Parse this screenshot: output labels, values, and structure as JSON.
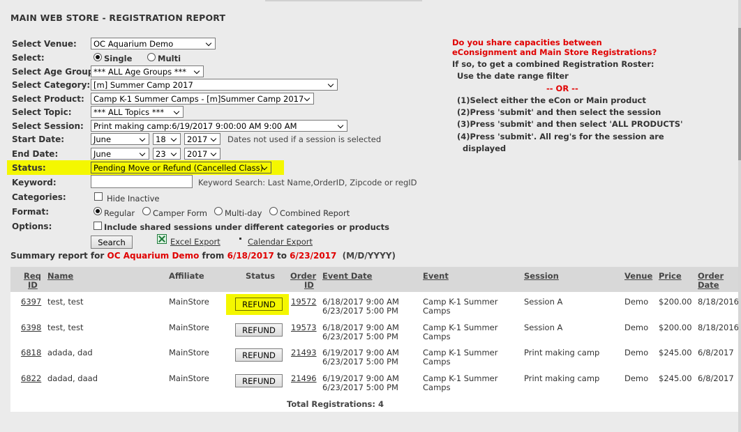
{
  "page_title": "MAIN WEB STORE - REGISTRATION REPORT",
  "form": {
    "venue_label": "Select Venue:",
    "venue_value": "OC Aquarium Demo",
    "select_label": "Select:",
    "select_options": [
      "Single",
      "Multi"
    ],
    "select_checked": "Single",
    "age_group_label": "Select Age Group:",
    "age_group_value": "*** ALL Age Groups ***",
    "category_label": "Select Category:",
    "category_value": "[m] Summer Camp 2017",
    "product_label": "Select Product:",
    "product_value": "Camp K-1 Summer Camps - [m]Summer Camp 2017",
    "topic_label": "Select Topic:",
    "topic_value": "*** ALL Topics ***",
    "session_label": "Select Session:",
    "session_value": "Print making camp:6/19/2017 9:00:00 AM 9:00 AM",
    "start_date_label": "Start Date:",
    "start_month": "June",
    "start_day": "18",
    "start_year": "2017",
    "dates_note": "Dates not used if a session is selected",
    "end_date_label": "End Date:",
    "end_month": "June",
    "end_day": "23",
    "end_year": "2017",
    "status_label": "Status:",
    "status_value": "Pending Move or Refund (Cancelled Class)",
    "keyword_label": "Keyword:",
    "keyword_value": "",
    "keyword_hint": "Keyword Search: Last Name,OrderID, Zipcode or regID",
    "categories_label": "Categories:",
    "hide_inactive_label": "Hide Inactive",
    "format_label": "Format:",
    "format_options": [
      "Regular",
      "Camper Form",
      "Multi-day",
      "Combined Report"
    ],
    "format_checked": "Regular",
    "options_label": "Options:",
    "include_shared_label": "Include shared sessions under different categories or products",
    "search_button": "Search",
    "excel_export": "Excel Export",
    "calendar_export": "Calendar Export"
  },
  "info": {
    "question_line1": "Do you share capacities between",
    "question_line2": "eConsignment and Main Store Registrations?",
    "intro": "If so, to get a combined Registration Roster:",
    "option_a": "Use the date range filter",
    "or": "-- OR --",
    "step1": "(1)Select either the eCon or Main product",
    "step2": "(2)Press 'submit' and then select the session",
    "step3": "(3)Press 'submit' and then select 'ALL PRODUCTS'",
    "step4a": "(4)Press 'submit'. All reg's for the session are",
    "step4b": "displayed"
  },
  "summary": {
    "prefix": "Summary report for",
    "venue": "OC Aquarium Demo",
    "from_word": "from",
    "from_date": "6/18/2017",
    "to_word": "to",
    "to_date": "6/23/2017",
    "format": "(M/D/YYYY)"
  },
  "table": {
    "headers": {
      "req_id_1": "Req",
      "req_id_2": "ID",
      "name": "Name",
      "affiliate": "Affiliate",
      "status": "Status",
      "order_id_1": "Order",
      "order_id_2": "ID",
      "event_date": "Event Date",
      "event": "Event",
      "session": "Session",
      "venue": "Venue",
      "price": "Price",
      "order_date_1": "Order",
      "order_date_2": "Date"
    },
    "rows": [
      {
        "req_id": "6397",
        "name": "test, test",
        "affiliate": "MainStore",
        "status_btn": "REFUND",
        "order_id": "19572",
        "event_date_1": "6/18/2017 9:00 AM",
        "event_date_2": "6/23/2017 5:00 PM",
        "event_1": "Camp K-1 Summer",
        "event_2": "Camps",
        "session": "Session A",
        "venue": "Demo",
        "price": "$200.00",
        "order_date": "8/18/2016"
      },
      {
        "req_id": "6398",
        "name": "test, test",
        "affiliate": "MainStore",
        "status_btn": "REFUND",
        "order_id": "19573",
        "event_date_1": "6/18/2017 9:00 AM",
        "event_date_2": "6/23/2017 5:00 PM",
        "event_1": "Camp K-1 Summer",
        "event_2": "Camps",
        "session": "Session A",
        "venue": "Demo",
        "price": "$200.00",
        "order_date": "8/18/2016"
      },
      {
        "req_id": "6818",
        "name": "adada, dad",
        "affiliate": "MainStore",
        "status_btn": "REFUND",
        "order_id": "21493",
        "event_date_1": "6/19/2017 9:00 AM",
        "event_date_2": "6/23/2017 5:00 PM",
        "event_1": "Camp K-1 Summer",
        "event_2": "Camps",
        "session": "Print making camp",
        "venue": "Demo",
        "price": "$245.00",
        "order_date": "6/8/2017"
      },
      {
        "req_id": "6822",
        "name": "dadad, daad",
        "affiliate": "MainStore",
        "status_btn": "REFUND",
        "order_id": "21496",
        "event_date_1": "6/19/2017 9:00 AM",
        "event_date_2": "6/23/2017 5:00 PM",
        "event_1": "Camp K-1 Summer",
        "event_2": "Camps",
        "session": "Print making camp",
        "venue": "Demo",
        "price": "$245.00",
        "order_date": "6/8/2017"
      }
    ],
    "total": "Total Registrations: 4"
  }
}
